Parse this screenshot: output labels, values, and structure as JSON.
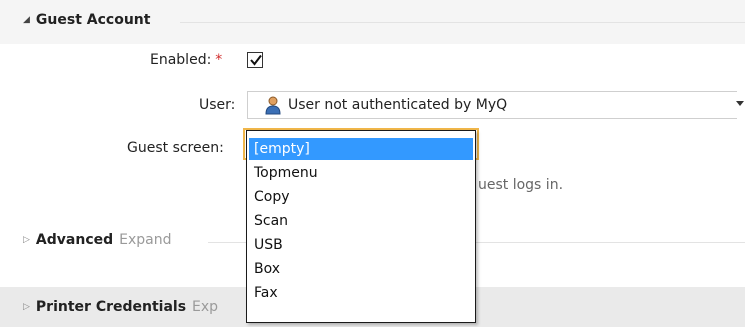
{
  "guest_section": {
    "title": "Guest Account",
    "enabled_label": "Enabled:",
    "required_mark": "*",
    "enabled_checked": true,
    "user_label": "User:",
    "user_value": "User not authenticated by MyQ",
    "guest_screen_label": "Guest screen:",
    "guest_screen_hint": "uest logs in.",
    "guest_screen_options": [
      {
        "label": "[empty]",
        "selected": true
      },
      {
        "label": "Topmenu",
        "selected": false
      },
      {
        "label": "Copy",
        "selected": false
      },
      {
        "label": "Scan",
        "selected": false
      },
      {
        "label": "USB",
        "selected": false
      },
      {
        "label": "Box",
        "selected": false
      },
      {
        "label": "Fax",
        "selected": false
      }
    ]
  },
  "advanced_section": {
    "title": "Advanced",
    "expand_label": "Expand"
  },
  "printer_section": {
    "title": "Printer Credentials",
    "expand_label": "Exp"
  },
  "colors": {
    "selection": "#3399ff",
    "focus_border": "#f0b64a",
    "required": "#d12b2b"
  },
  "icons": {
    "collapse": "triangle-down-icon",
    "expand": "triangle-right-icon",
    "user": "user-icon",
    "check": "check-icon",
    "dropdown": "chevron-down-icon"
  }
}
